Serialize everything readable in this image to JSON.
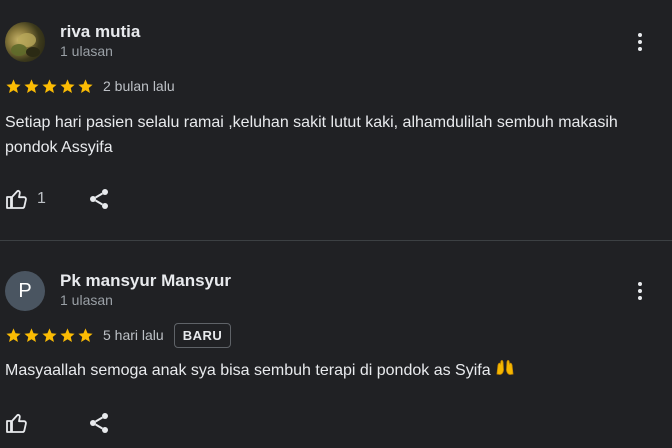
{
  "reviews": [
    {
      "name": "riva mutia",
      "avatar": "photo-avatar",
      "review_count": "1 ulasan",
      "rating": 5,
      "when": "2 bulan lalu",
      "badge": "",
      "text": "Setiap hari pasien selalu ramai ,keluhan sakit lutut kaki, alhamdulilah sembuh makasih pondok Assyifa",
      "likes": "1"
    },
    {
      "name": "Pk mansyur Mansyur",
      "avatar_letter": "P",
      "review_count": "1 ulasan",
      "rating": 5,
      "when": "5 hari lalu",
      "badge": "BARU",
      "text": "Masyaallah semoga anak sya bisa sembuh terapi di pondok as Syifa",
      "emoji": "raising-hands-emoji",
      "likes": ""
    }
  ],
  "colors": {
    "background": "#202124",
    "star": "#fbbc04",
    "text": "#e8eaed",
    "muted": "#9aa0a6",
    "divider": "#3c4043"
  },
  "icons": [
    "more-vert-icon",
    "thumb-up-icon",
    "share-icon",
    "star-icon"
  ]
}
